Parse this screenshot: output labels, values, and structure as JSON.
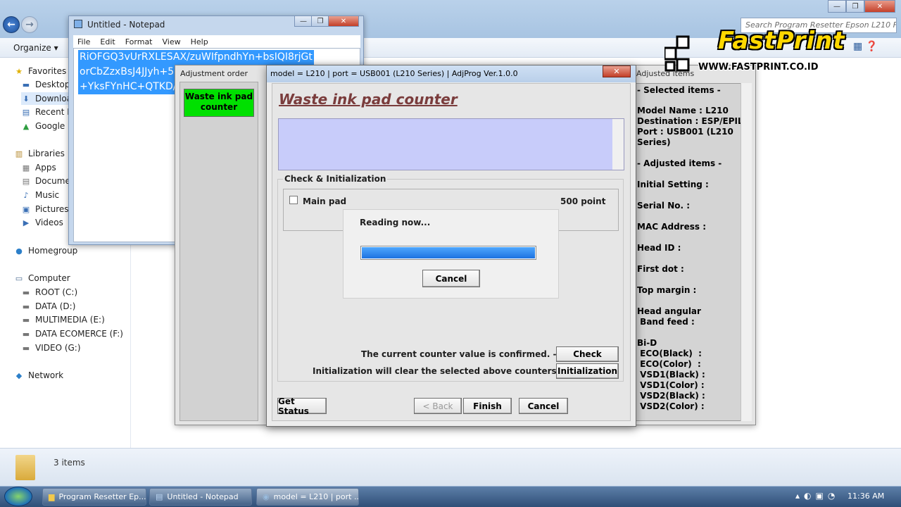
{
  "explorer": {
    "search_placeholder": "Search Program Resetter Epson L210 F...",
    "organize_label": "Organize ▾",
    "nav": {
      "favorites": "Favorites",
      "desktop": "Desktop",
      "downloads": "Downloa",
      "recent": "Recent Pl",
      "google_drive": "Google D",
      "libraries": "Libraries",
      "apps": "Apps",
      "documents": "Documen",
      "music": "Music",
      "pictures": "Pictures",
      "videos": "Videos",
      "homegroup": "Homegroup",
      "computer": "Computer",
      "root": "ROOT (C:)",
      "data": "DATA (D:)",
      "multimedia": "MULTIMEDIA (E:)",
      "data_ecomerce": "DATA ECOMERCE (F:)",
      "video": "VIDEO (G:)",
      "network": "Network"
    },
    "status_items": "3 items"
  },
  "notepad": {
    "title": "Untitled - Notepad",
    "menu": [
      "File",
      "Edit",
      "Format",
      "View",
      "Help"
    ],
    "lines": [
      "RiOFGQ3vUrRXLESAX/zuWIfpndhYn+bsIQI8rjGt",
      "orCbZzxBsJ4JJyh+5",
      "+YksFYnHC+QTKD/"
    ]
  },
  "adjustment": {
    "left_header": "Adjustment order",
    "waste_button": "Waste ink pad counter",
    "right_header": "Adjusted items",
    "info": {
      "selected": "- Selected items -",
      "model": "Model Name : L210",
      "destination": "Destination : ESP/EPIL",
      "port": "Port : USB001 (L210\nSeries)",
      "adjusted": "- Adjusted items -",
      "initial": "Initial Setting :",
      "serial": "Serial No. :",
      "mac": "MAC Address :",
      "head": "Head ID :",
      "first_dot": "First dot :",
      "top_margin": "Top margin :",
      "head_angular": "Head angular\n Band feed :",
      "bid": "Bi-D\n ECO(Black)  :\n ECO(Color)  :\n VSD1(Black) :\n VSD1(Color) :\n VSD2(Black) :\n VSD2(Color) :"
    }
  },
  "dialog": {
    "title": "model = L210 | port = USB001 (L210 Series) | AdjProg Ver.1.0.0",
    "close_glyph": "✕",
    "heading": "Waste ink pad counter",
    "group_label": "Check & Initialization",
    "main_pad": "Main pad",
    "points": "500 point",
    "confirm_text": "The current counter value is confirmed. -->",
    "init_text": "Initialization will clear the selected above counters. -->",
    "check_btn": "Check",
    "init_btn": "Initialization",
    "get_status": "Get Status",
    "back_btn": "< Back",
    "finish_btn": "Finish",
    "cancel_btn": "Cancel"
  },
  "reading": {
    "text": "Reading now...",
    "cancel": "Cancel",
    "progress": 1.0
  },
  "logo": {
    "name": "FastPrint",
    "url": "WWW.FASTPRINT.CO.ID"
  },
  "taskbar": {
    "tasks": [
      "Program Resetter Ep...",
      "Untitled - Notepad",
      "model = L210 | port ..."
    ],
    "clock": "11:36 AM"
  },
  "colors": {
    "waste_button": "#00e000",
    "heading": "#7a3c3c",
    "message_area": "#c8ccfa",
    "progress": "#1c72e0"
  }
}
